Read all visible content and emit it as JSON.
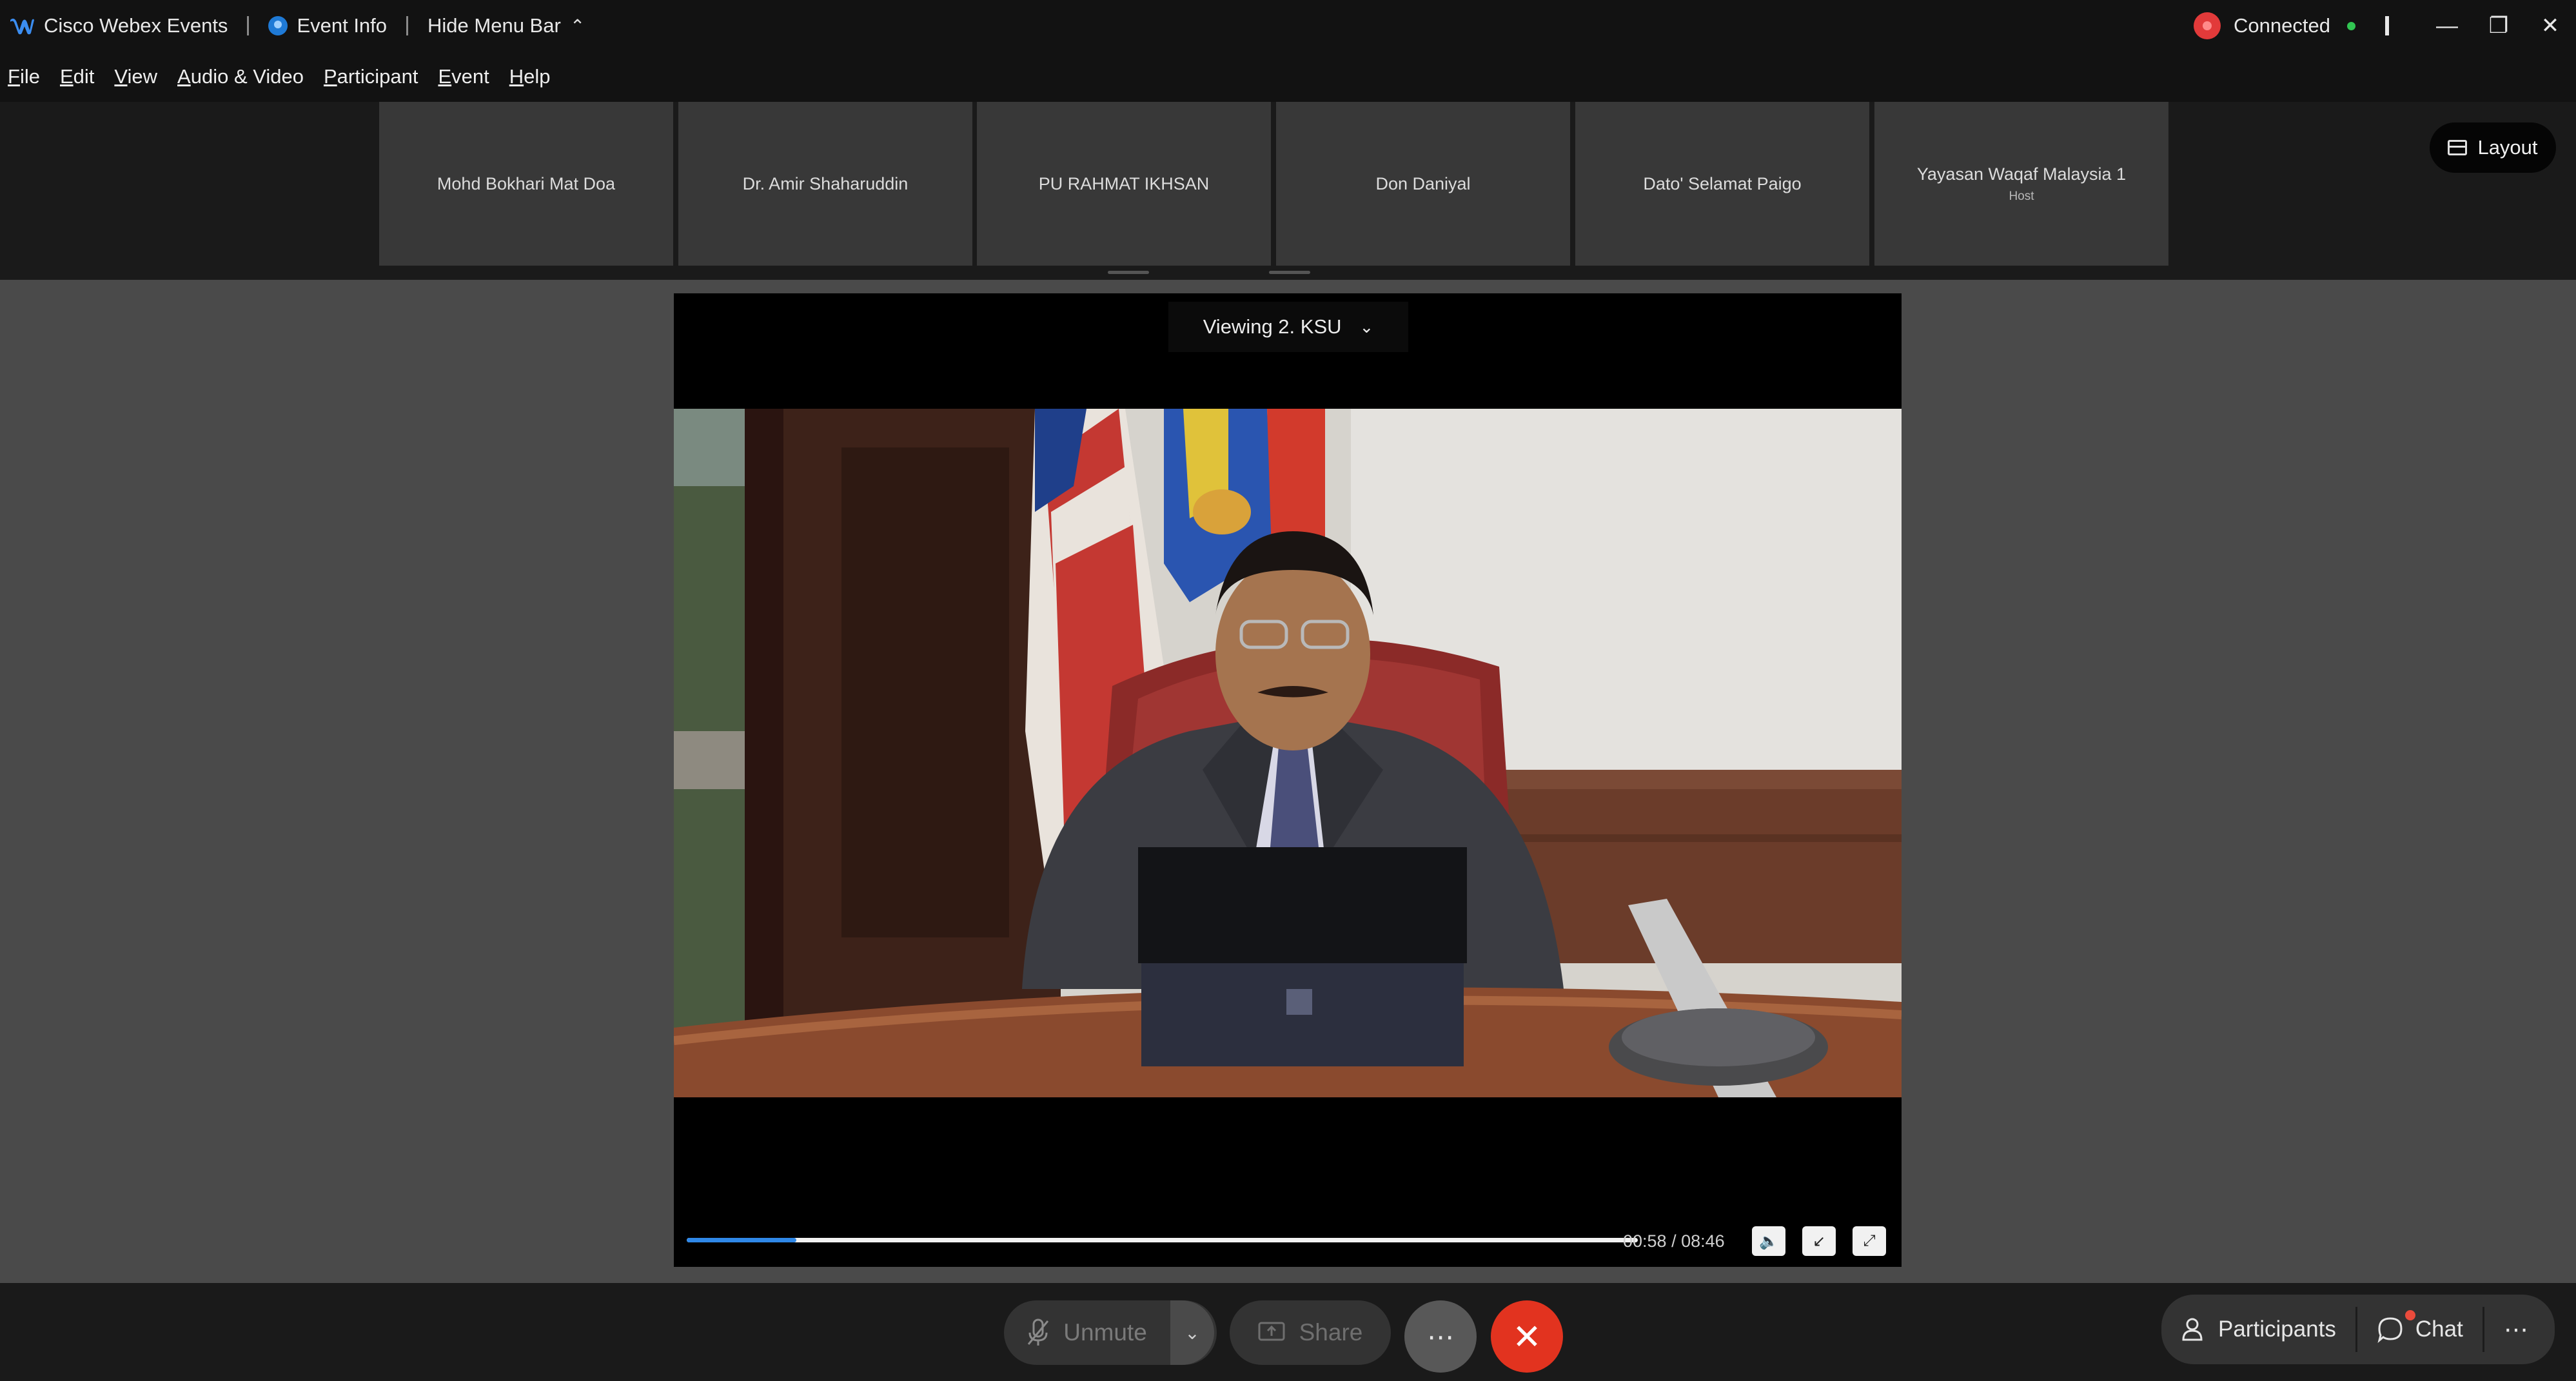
{
  "titlebar": {
    "app_name": "Cisco Webex Events",
    "event_info": "Event Info",
    "hide_menu_bar": "Hide Menu Bar",
    "status": "Connected"
  },
  "menu": {
    "items": [
      {
        "label_ul": "F",
        "label_rest": "ile"
      },
      {
        "label_ul": "E",
        "label_rest": "dit"
      },
      {
        "label_ul": "V",
        "label_rest": "iew"
      },
      {
        "label_ul": "A",
        "label_rest": "udio & Video"
      },
      {
        "label_ul": "P",
        "label_rest": "articipant"
      },
      {
        "label_ul": "E",
        "label_rest": "vent"
      },
      {
        "label_ul": "H",
        "label_rest": "elp"
      }
    ]
  },
  "participants": [
    {
      "name": "Mohd Bokhari Mat Doa",
      "role": ""
    },
    {
      "name": "Dr. Amir Shaharuddin",
      "role": ""
    },
    {
      "name": "PU RAHMAT IKHSAN",
      "role": ""
    },
    {
      "name": "Don Daniyal",
      "role": ""
    },
    {
      "name": "Dato' Selamat Paigo",
      "role": ""
    },
    {
      "name": "Yayasan Waqaf Malaysia 1",
      "role": "Host"
    }
  ],
  "layout_button": "Layout",
  "viewing": {
    "label": "Viewing 2. KSU"
  },
  "player": {
    "time": "00:58 / 08:46",
    "progress": 0.115
  },
  "toolbar": {
    "unmute": "Unmute",
    "share": "Share",
    "participants": "Participants",
    "chat": "Chat"
  },
  "colors": {
    "accent_blue": "#2f88e8",
    "end_red": "#e2331f",
    "connected_green": "#31c552"
  }
}
